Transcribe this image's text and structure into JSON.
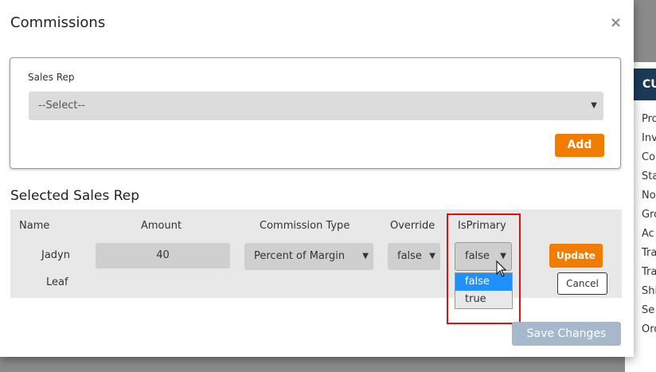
{
  "background": {
    "panel_header": "CU",
    "panel_items": [
      "Pro",
      "Inv",
      "Co",
      "Sta",
      "No",
      "Gro",
      "Ac",
      "Tra",
      "Tra",
      "Shi",
      "Se",
      "Ord"
    ]
  },
  "modal": {
    "title": "Commissions",
    "close_icon": "×",
    "sales_rep": {
      "label": "Sales Rep",
      "select_value": "--Select--",
      "add_label": "Add"
    },
    "selected_heading": "Selected Sales Rep",
    "table": {
      "headers": [
        "Name",
        "Amount",
        "Commission Type",
        "Override",
        "IsPrimary"
      ],
      "row": {
        "name_first": "Jadyn",
        "name_last": "Leaf",
        "amount": "40",
        "commission_type": "Percent of Margin",
        "override": "false",
        "is_primary": "false",
        "update_label": "Update",
        "cancel_label": "Cancel"
      }
    },
    "is_primary_options": [
      "false",
      "true"
    ],
    "is_primary_highlighted_option": "false",
    "save_label": "Save Changes"
  },
  "colors": {
    "accent_orange": "#f07c00",
    "save_disabled": "#a6b9cc",
    "highlight_red": "#e01010",
    "selected_option_blue": "#1e90ff"
  },
  "icons": {
    "close": "close-icon",
    "dropdown": "chevron-down-icon",
    "cursor": "mouse-pointer-icon"
  }
}
